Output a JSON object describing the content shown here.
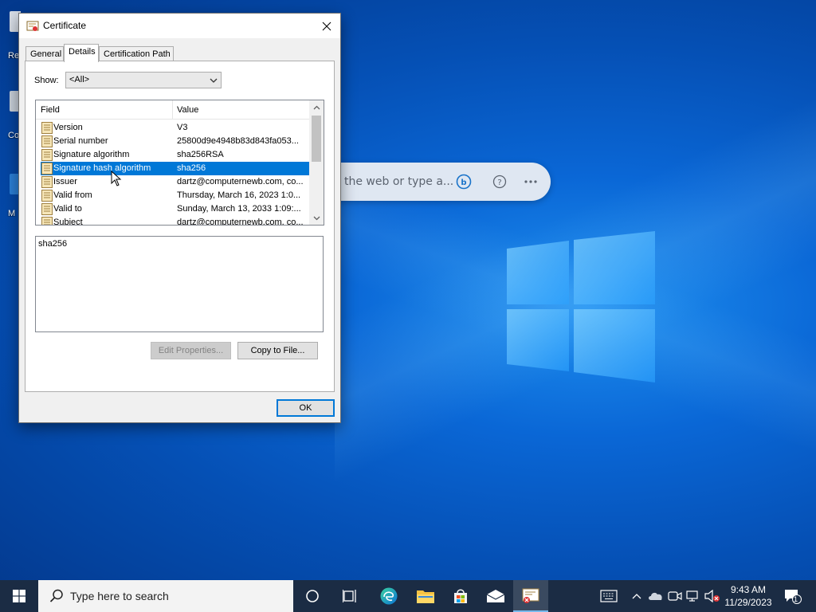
{
  "desktop": {
    "icons": [
      {
        "label": "Re"
      },
      {
        "label": "Co"
      },
      {
        "label": "M"
      }
    ]
  },
  "search_flyout": {
    "placeholder": "the web or type a..."
  },
  "dialog": {
    "title": "Certificate",
    "tabs": [
      {
        "label": "General"
      },
      {
        "label": "Details"
      },
      {
        "label": "Certification Path"
      }
    ],
    "active_tab": "Details",
    "show": {
      "label": "Show:",
      "selected": "<All>"
    },
    "columns": {
      "field": "Field",
      "value": "Value"
    },
    "rows": [
      {
        "field": "Version",
        "value": "V3"
      },
      {
        "field": "Serial number",
        "value": "25800d9e4948b83d843fa053..."
      },
      {
        "field": "Signature algorithm",
        "value": "sha256RSA"
      },
      {
        "field": "Signature hash algorithm",
        "value": "sha256"
      },
      {
        "field": "Issuer",
        "value": "dartz@computernewb.com, co..."
      },
      {
        "field": "Valid from",
        "value": "Thursday, March 16, 2023 1:0..."
      },
      {
        "field": "Valid to",
        "value": "Sunday, March 13, 2033 1:09:..."
      },
      {
        "field": "Subject",
        "value": "dartz@computernewb.com, co..."
      }
    ],
    "selected_row": "Signature hash algorithm",
    "detail_text": "sha256",
    "edit_properties_label": "Edit Properties...",
    "copy_to_file_label": "Copy to File...",
    "ok_label": "OK"
  },
  "taskbar": {
    "search_placeholder": "Type here to search",
    "time": "9:43 AM",
    "date": "11/29/2023",
    "notification_count": "1"
  },
  "colors": {
    "selection": "#0078d7",
    "taskbar": "#1b2c44"
  }
}
